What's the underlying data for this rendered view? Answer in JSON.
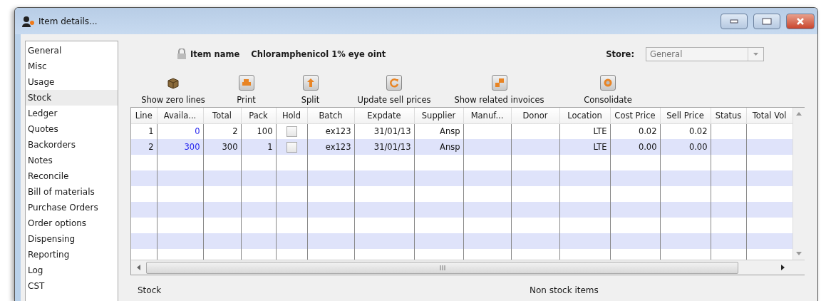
{
  "window": {
    "title": "Item details..."
  },
  "sidebar": {
    "items": [
      {
        "label": "General",
        "selected": false
      },
      {
        "label": "Misc",
        "selected": false
      },
      {
        "label": "Usage",
        "selected": false
      },
      {
        "label": "Stock",
        "selected": true
      },
      {
        "label": "Ledger",
        "selected": false
      },
      {
        "label": "Quotes",
        "selected": false
      },
      {
        "label": "Backorders",
        "selected": false
      },
      {
        "label": "Notes",
        "selected": false
      },
      {
        "label": "Reconcile",
        "selected": false
      },
      {
        "label": "Bill of materials",
        "selected": false
      },
      {
        "label": "Purchase Orders",
        "selected": false
      },
      {
        "label": "Order options",
        "selected": false
      },
      {
        "label": "Dispensing",
        "selected": false
      },
      {
        "label": "Reporting",
        "selected": false
      },
      {
        "label": "Log",
        "selected": false
      },
      {
        "label": "CST",
        "selected": false
      }
    ]
  },
  "item_name": {
    "label": "Item name",
    "value": "Chloramphenicol 1% eye oint"
  },
  "store": {
    "label": "Store:",
    "value": "General"
  },
  "toolbar": [
    {
      "kind": "box",
      "label": "Show zero lines"
    },
    {
      "kind": "print",
      "label": "Print"
    },
    {
      "kind": "split",
      "label": "Split"
    },
    {
      "kind": "refresh",
      "label": "Update sell prices"
    },
    {
      "kind": "invoices",
      "label": "Show related invoices"
    },
    {
      "kind": "consolidate",
      "label": "Consolidate"
    }
  ],
  "table": {
    "columns": [
      "Line",
      "Availa...",
      "Total",
      "Pack",
      "Hold",
      "Batch",
      "Expdate",
      "Supplier",
      "Manuf...",
      "Donor",
      "Location",
      "Cost Price",
      "Sell Price",
      "Status",
      "Total Vol"
    ],
    "rows": [
      {
        "line": "1",
        "available": "0",
        "total": "2",
        "pack": "100",
        "hold": false,
        "batch": "ex123",
        "expdate": "31/01/13",
        "supplier": "Ansp",
        "location": "LTE",
        "cost_price": "0.02",
        "sell_price": "0.02"
      },
      {
        "line": "2",
        "available": "300",
        "total": "300",
        "pack": "1",
        "hold": false,
        "batch": "ex123",
        "expdate": "31/01/13",
        "supplier": "Ansp",
        "location": "LTE",
        "cost_price": "0.00",
        "sell_price": "0.00"
      }
    ]
  },
  "sections": [
    "Stock",
    "Non stock items"
  ]
}
